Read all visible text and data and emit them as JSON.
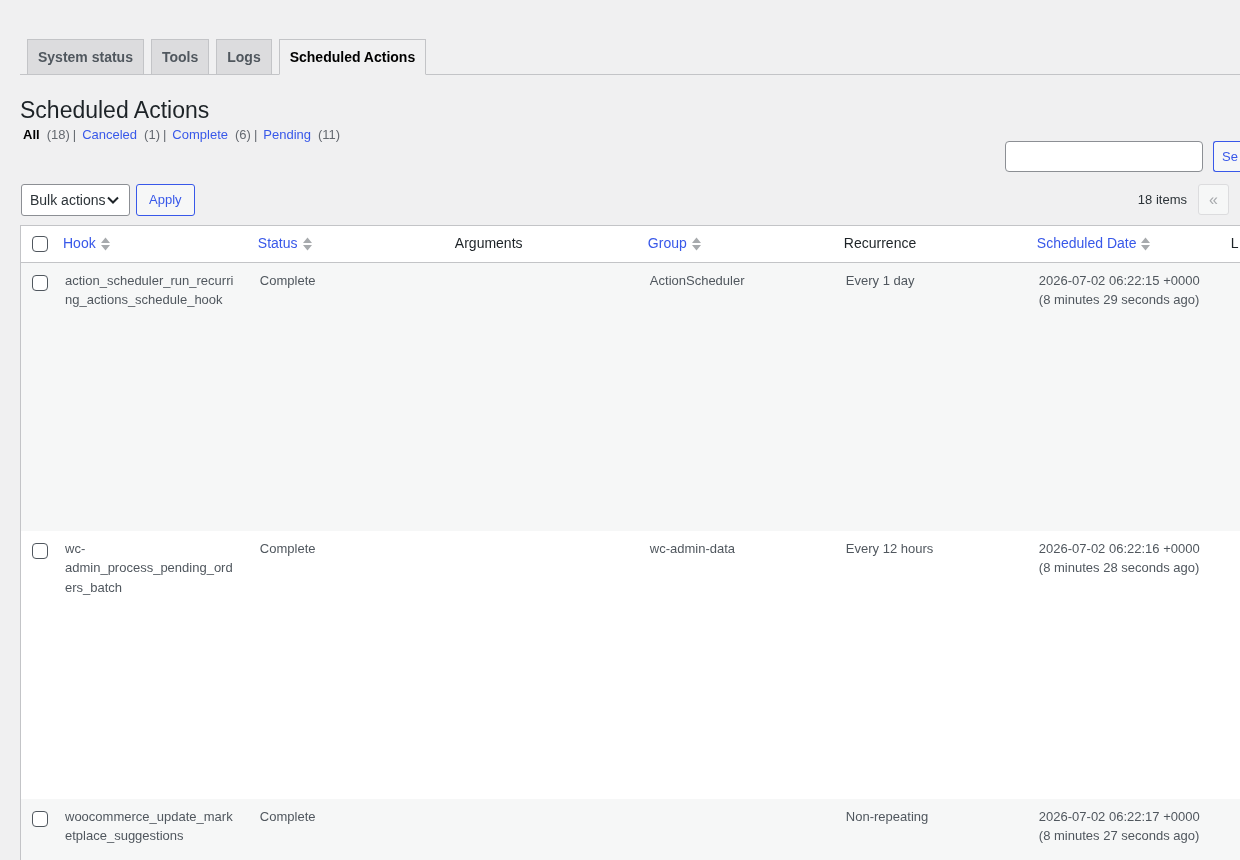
{
  "tabs": [
    {
      "label": "System status",
      "selected": false
    },
    {
      "label": "Tools",
      "selected": false
    },
    {
      "label": "Logs",
      "selected": false
    },
    {
      "label": "Scheduled Actions",
      "selected": true
    }
  ],
  "heading": "Scheduled Actions",
  "filters": [
    {
      "label": "All",
      "count": "(18)",
      "selected": true,
      "separator": "|"
    },
    {
      "label": "Canceled",
      "count": "(1)",
      "selected": false,
      "separator": "|"
    },
    {
      "label": "Complete",
      "count": "(6)",
      "selected": false,
      "separator": "|"
    },
    {
      "label": "Pending",
      "count": "(11)",
      "selected": false
    }
  ],
  "search": {
    "button": "Se"
  },
  "bulk_actions": {
    "select": "Bulk actions",
    "apply": "Apply"
  },
  "pagination": {
    "count": "18 items",
    "buttons": [
      {
        "label": "«",
        "disabled": true
      }
    ]
  },
  "table": {
    "select_all_checked": false,
    "columns": [
      {
        "label": "Hook",
        "sortable": true
      },
      {
        "label": "Status",
        "sortable": true
      },
      {
        "label": "Arguments",
        "sortable": false
      },
      {
        "label": "Group",
        "sortable": true
      },
      {
        "label": "Recurrence",
        "sortable": false
      },
      {
        "label": "Scheduled Date",
        "sortable": true
      },
      {
        "label": "L",
        "sortable": false
      }
    ],
    "rows": [
      {
        "checked": false,
        "hook": "action_scheduler_run_recurring_actions_schedule_hook",
        "status": "Complete",
        "group": "ActionScheduler",
        "recurrence": "Every 1 day",
        "scheduled_date": "2026-07-02 06:22:15 +0000",
        "time_ago": "(8 minutes 29 seconds ago)"
      },
      {
        "checked": false,
        "hook": "wc-admin_process_pending_orders_batch",
        "status": "Complete",
        "group": "wc-admin-data",
        "recurrence": "Every 12 hours",
        "scheduled_date": "2026-07-02 06:22:16 +0000",
        "time_ago": "(8 minutes 28 seconds ago)"
      },
      {
        "checked": false,
        "hook": "woocommerce_update_marketplace_suggestions",
        "status": "Complete",
        "recurrence": "Non-repeating",
        "scheduled_date": "2026-07-02 06:22:17 +0000",
        "time_ago": "(8 minutes 27 seconds ago)"
      }
    ]
  }
}
